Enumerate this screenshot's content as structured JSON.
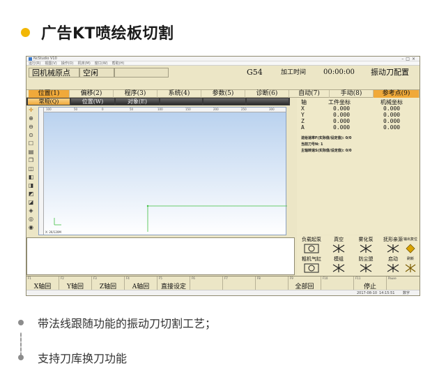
{
  "header": {
    "title": "广告KT喷绘板切割",
    "dot_color": "#f2b705"
  },
  "app": {
    "window_title": "NcStudio V10",
    "menus": [
      "运行(R)",
      "视图(V)",
      "操作(O)",
      "机床(M)",
      "窗口(W)",
      "帮助(H)"
    ],
    "status": {
      "mode": "回机械原点",
      "state": "空闲",
      "coord_system": "G54",
      "time_label": "加工时间",
      "time_value": "00:00:00",
      "config_button": "振动刀配置"
    },
    "tabs": [
      {
        "label": "位置(1)",
        "active": true
      },
      {
        "label": "偏移(2)",
        "active": false
      },
      {
        "label": "程序(3)",
        "active": false
      },
      {
        "label": "系统(4)",
        "active": false
      },
      {
        "label": "参数(5)",
        "active": false
      },
      {
        "label": "诊断(6)",
        "active": false
      },
      {
        "label": "自动(7)",
        "active": false
      },
      {
        "label": "手动(8)",
        "active": false
      },
      {
        "label": "参考点(9)",
        "active": true
      }
    ],
    "subtabs": [
      {
        "label": "常规(Q)",
        "active": true
      },
      {
        "label": "位置(W)",
        "active": false
      },
      {
        "label": "对象(E)",
        "active": false
      }
    ],
    "toolbar_icons": [
      "crosshair-icon",
      "zoom-in-icon",
      "zoom-out-icon",
      "fit-view-icon",
      "frame-icon",
      "window-icon",
      "copy-icon",
      "layers-icon",
      "cube-front-icon",
      "cube-side-icon",
      "cube-top-icon",
      "cube-3d-icon",
      "iso-view-icon",
      "rotate-icon",
      "reset-view-icon"
    ],
    "ruler_ticks": [
      "100",
      "50",
      "0",
      "50",
      "100",
      "150",
      "200",
      "250",
      "300"
    ],
    "canvas_readout": "X: 26/120M",
    "coords": {
      "header_axis": "轴",
      "header_work": "工件坐标",
      "header_machine": "机械坐标",
      "rows": [
        {
          "axis": "X",
          "work": "0.000",
          "machine": "0.000"
        },
        {
          "axis": "Y",
          "work": "0.000",
          "machine": "0.000"
        },
        {
          "axis": "Z",
          "work": "0.000",
          "machine": "0.000"
        },
        {
          "axis": "A",
          "work": "0.000",
          "machine": "0.000"
        }
      ]
    },
    "info_lines": [
      {
        "label": "进给速率F(实际值/设定值):",
        "value": "0/0"
      },
      {
        "label": "当前刀号N:",
        "value": "1"
      },
      {
        "label": "主轴转速S(实际值/设定值):",
        "value": "0/0"
      }
    ],
    "function_buttons": [
      {
        "label": "负载起泵",
        "icon": "pump-icon"
      },
      {
        "label": "真空",
        "icon": "vacuum-icon"
      },
      {
        "label": "雾化泵",
        "icon": "mist-pump-icon"
      },
      {
        "label": "抚形亲源",
        "icon": "source-icon"
      },
      {
        "label": "输出复位",
        "icon": "output-reset-icon"
      },
      {
        "label": "粗机气缸",
        "icon": "cylinder-icon"
      },
      {
        "label": "模组",
        "icon": "module-icon"
      },
      {
        "label": "防尘盟",
        "icon": "dust-cover-icon"
      },
      {
        "label": "启动",
        "icon": "start-icon"
      },
      {
        "label": "刷新",
        "icon": "refresh-icon"
      }
    ],
    "fkeys": [
      {
        "key": "F1",
        "label": "X轴回"
      },
      {
        "key": "F2",
        "label": "Y轴回"
      },
      {
        "key": "F3",
        "label": "Z轴回"
      },
      {
        "key": "F4",
        "label": "A轴回"
      },
      {
        "key": "F5",
        "label": "直接设定"
      },
      {
        "key": "F6",
        "label": ""
      },
      {
        "key": "F7",
        "label": ""
      },
      {
        "key": "F8",
        "label": ""
      },
      {
        "key": "F9",
        "label": "全部回"
      },
      {
        "key": "F10",
        "label": ""
      },
      {
        "key": "F11",
        "label": "停止"
      },
      {
        "key": "Pause",
        "label": ""
      }
    ],
    "taskbar": {
      "date": "2017-08-10",
      "time": "14:15:51",
      "extra": "数字"
    },
    "colors": {
      "window_bg": "#ece6c6",
      "tab_active": "#f0a93a",
      "canvas_top": "#b7d0ee",
      "path_line": "#3fbf3f"
    }
  },
  "bullets": [
    {
      "text": "带法线跟随功能的振动刀切割工艺；"
    },
    {
      "text": "支持刀库换刀功能"
    }
  ]
}
